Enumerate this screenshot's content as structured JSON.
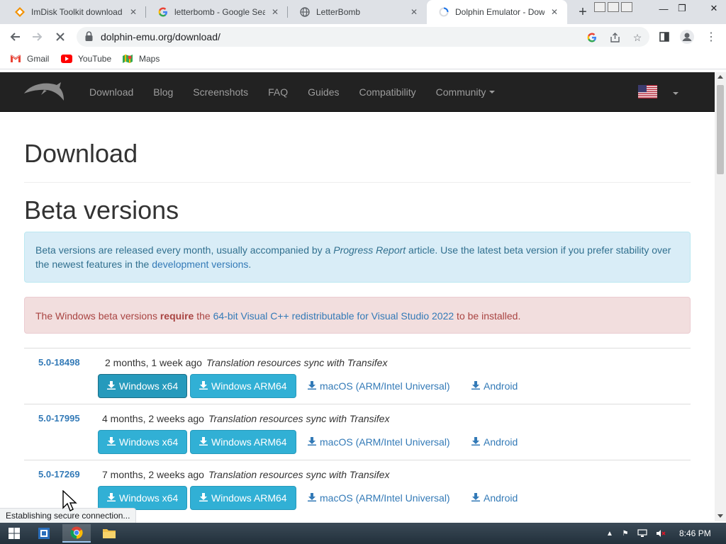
{
  "browser": {
    "tabs": [
      {
        "title": "ImDisk Toolkit download",
        "icon": "imdisk-icon"
      },
      {
        "title": "letterbomb - Google Sea",
        "icon": "google-icon"
      },
      {
        "title": "LetterBomb",
        "icon": "globe-icon"
      },
      {
        "title": "Dolphin Emulator - Dowl",
        "icon": "loading-spinner-icon",
        "active": true
      }
    ],
    "url": "dolphin-emu.org/download/",
    "bookmarks": [
      {
        "label": "Gmail",
        "icon": "gmail-icon"
      },
      {
        "label": "YouTube",
        "icon": "youtube-icon"
      },
      {
        "label": "Maps",
        "icon": "maps-icon"
      }
    ],
    "status_text": "Establishing secure connection..."
  },
  "site": {
    "nav": [
      "Download",
      "Blog",
      "Screenshots",
      "FAQ",
      "Guides",
      "Compatibility",
      "Community"
    ],
    "language_flag": "us-flag-icon"
  },
  "page": {
    "title": "Download",
    "section_title": "Beta versions",
    "info_alert": {
      "text1": "Beta versions are released every month, usually accompanied by a ",
      "italic": "Progress Report",
      "text2": " article. Use the latest beta version if you prefer stability over the newest features in the ",
      "link": "development versions",
      "text3": "."
    },
    "danger_alert": {
      "text1": "The Windows beta versions ",
      "bold": "require",
      "text2": " the ",
      "link": "64-bit Visual C++ redistributable for Visual Studio 2022",
      "text3": " to be installed."
    },
    "versions": [
      {
        "version": "5.0-18498",
        "age": "2 months, 1 week ago",
        "message": "Translation resources sync with Transifex"
      },
      {
        "version": "5.0-17995",
        "age": "4 months, 2 weeks ago",
        "message": "Translation resources sync with Transifex"
      },
      {
        "version": "5.0-17269",
        "age": "7 months, 2 weeks ago",
        "message": "Translation resources sync with Transifex"
      }
    ],
    "buttons": {
      "win_x64": "Windows x64",
      "win_arm64": "Windows ARM64",
      "macos": "macOS (ARM/Intel Universal)",
      "android": "Android"
    }
  },
  "taskbar": {
    "clock": "8:46 PM"
  },
  "colors": {
    "navbar": "#222222",
    "info_bg": "#d9edf7",
    "danger_bg": "#f2dede",
    "button": "#31b0d5",
    "link": "#337ab7"
  }
}
